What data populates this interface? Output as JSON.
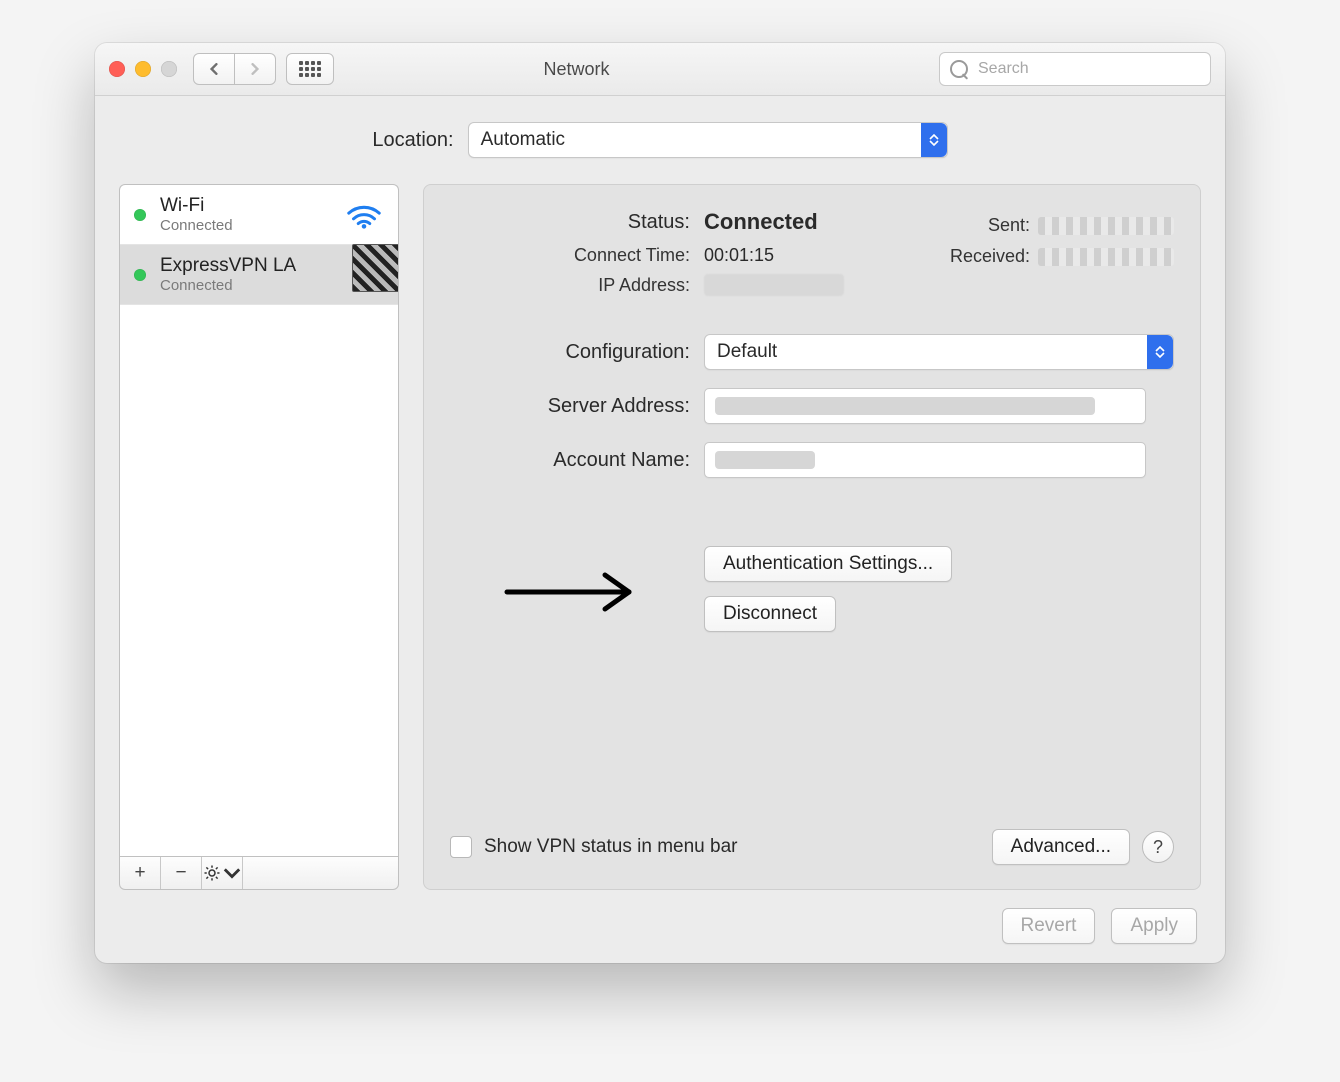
{
  "toolbar": {
    "title": "Network",
    "search_placeholder": "Search"
  },
  "location": {
    "label": "Location:",
    "value": "Automatic"
  },
  "sidebar": {
    "items": [
      {
        "name": "Wi-Fi",
        "status": "Connected"
      },
      {
        "name": "ExpressVPN LA",
        "status": "Connected"
      }
    ],
    "toolbar": {
      "add": "+",
      "remove": "−"
    }
  },
  "details": {
    "status_label": "Status:",
    "status_value": "Connected",
    "connect_time_label": "Connect Time:",
    "connect_time_value": "00:01:15",
    "ip_label": "IP Address:",
    "sent_label": "Sent:",
    "received_label": "Received:",
    "configuration_label": "Configuration:",
    "configuration_value": "Default",
    "server_label": "Server Address:",
    "account_label": "Account Name:",
    "auth_button": "Authentication Settings...",
    "disconnect_button": "Disconnect",
    "show_vpn_label": "Show VPN status in menu bar",
    "advanced_button": "Advanced...",
    "help_button": "?"
  },
  "footer": {
    "revert": "Revert",
    "apply": "Apply"
  }
}
